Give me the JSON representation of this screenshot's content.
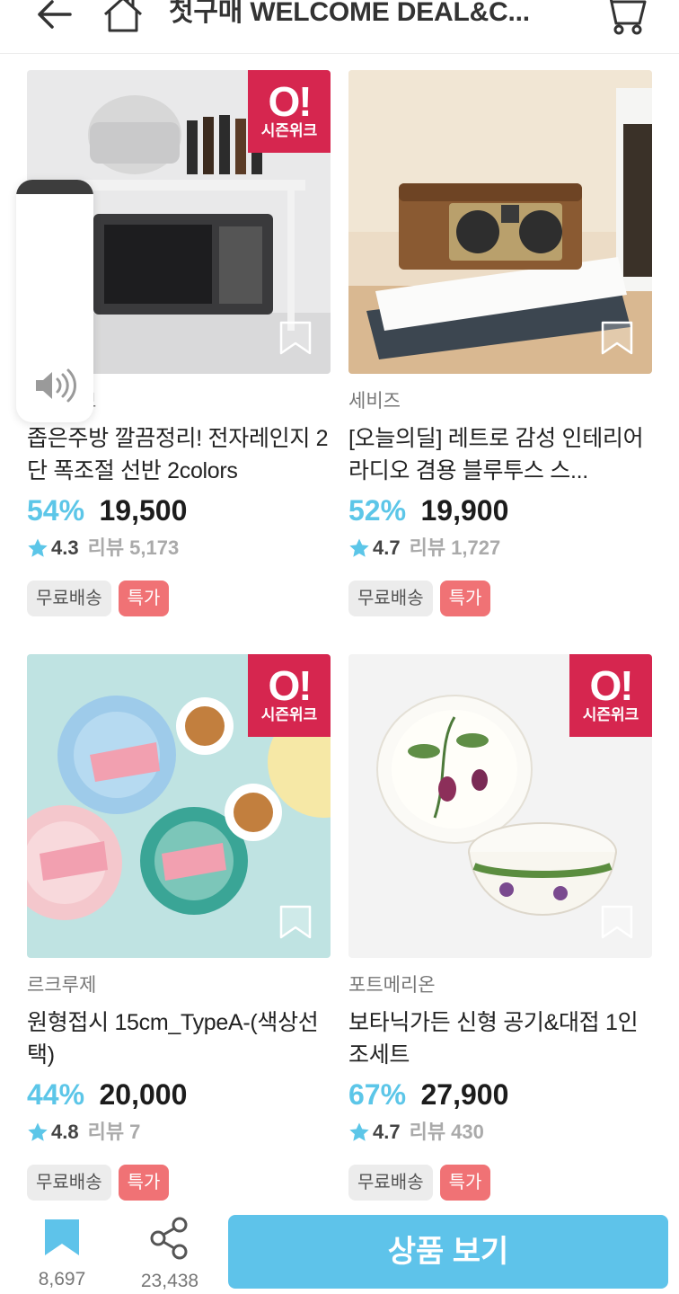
{
  "header": {
    "title": "첫구매 WELCOME DEAL&C...",
    "back_icon": "arrow-left-icon",
    "home_icon": "home-icon",
    "cart_icon": "cart-icon"
  },
  "products": [
    {
      "brand": "홈올리브",
      "name": "좁은주방 깔끔정리! 전자레인지 2단 폭조절 선반 2colors",
      "discount": "54%",
      "price": "19,500",
      "rating": "4.3",
      "reviews": "리뷰 5,173",
      "tag_free": "무료배송",
      "tag_special": "특가",
      "badge": true,
      "image": "microwave-shelf-photo"
    },
    {
      "brand": "세비즈",
      "name": "[오늘의딜] 레트로 감성 인테리어 라디오 겸용 블루투스 스...",
      "discount": "52%",
      "price": "19,900",
      "rating": "4.7",
      "reviews": "리뷰 1,727",
      "tag_free": "무료배송",
      "tag_special": "특가",
      "badge": false,
      "image": "retro-radio-photo"
    },
    {
      "brand": "르크루제",
      "name": "원형접시 15cm_TypeA-(색상선택)",
      "discount": "44%",
      "price": "20,000",
      "rating": "4.8",
      "reviews": "리뷰 7",
      "tag_free": "무료배송",
      "tag_special": "특가",
      "badge": true,
      "image": "round-plates-photo"
    },
    {
      "brand": "포트메리온",
      "name": "보타닉가든 신형 공기&대접 1인조세트",
      "discount": "67%",
      "price": "27,900",
      "rating": "4.7",
      "reviews": "리뷰 430",
      "tag_free": "무료배송",
      "tag_special": "특가",
      "badge": true,
      "image": "botanic-bowls-photo"
    }
  ],
  "badge": {
    "big": "O!",
    "small": "시즌위크"
  },
  "bottom_bar": {
    "bookmark_count": "8,697",
    "share_count": "23,438",
    "cta_label": "상품 보기"
  },
  "colors": {
    "accent": "#5ec3ea",
    "discount": "#5cc6e8",
    "badge": "#d6264f",
    "special_tag": "#f07275"
  }
}
